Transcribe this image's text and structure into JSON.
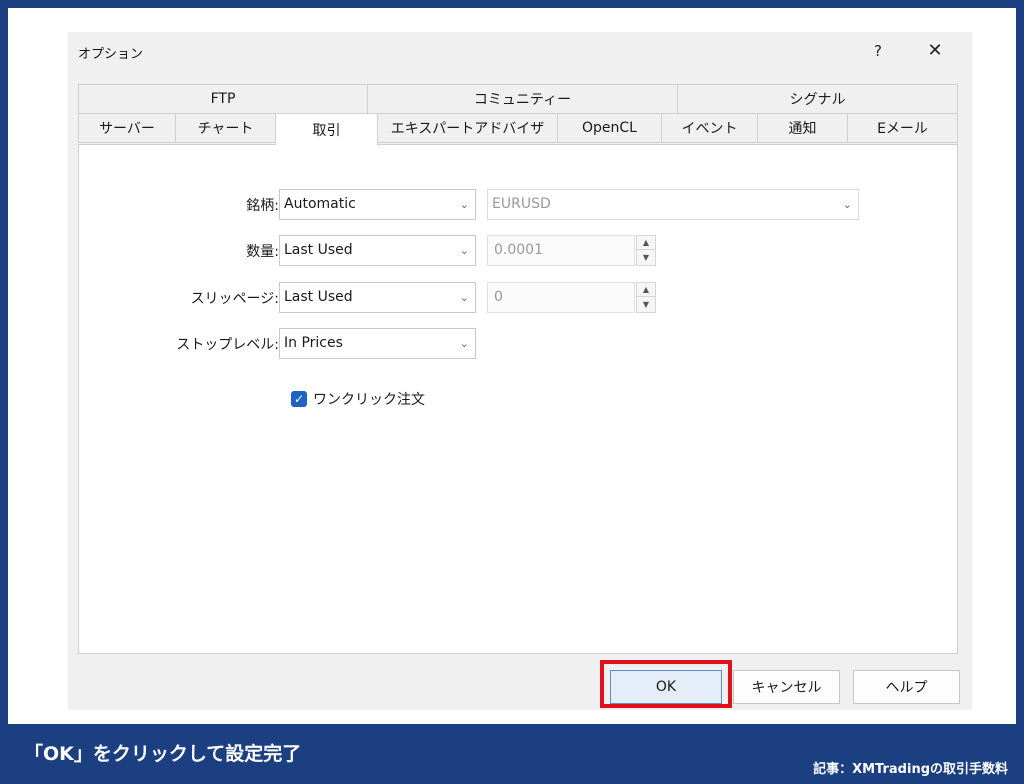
{
  "dialog": {
    "title": "オプション",
    "help": "?",
    "close": "✕"
  },
  "tabs_top": [
    "FTP",
    "コミュニティー",
    "シグナル"
  ],
  "tabs_bottom": [
    "サーバー",
    "チャート",
    "取引",
    "エキスパートアドバイザ",
    "OpenCL",
    "イベント",
    "通知",
    "Eメール"
  ],
  "active_tab": "取引",
  "form": {
    "symbol_label": "銘柄:",
    "symbol_select": "Automatic",
    "symbol_value": "EURUSD",
    "volume_label": "数量:",
    "volume_select": "Last Used",
    "volume_value": "0.0001",
    "slippage_label": "スリッページ:",
    "slippage_select": "Last Used",
    "slippage_value": "0",
    "stoplevel_label": "ストップレベル:",
    "stoplevel_select": "In Prices",
    "oneclick_label": "ワンクリック注文",
    "oneclick_checked": true
  },
  "buttons": {
    "ok": "OK",
    "cancel": "キャンセル",
    "help": "ヘルプ"
  },
  "caption": "「OK」をクリックして設定完了",
  "credit": "記事：XMTradingの取引手数料",
  "colors": {
    "background": "#1b3f80",
    "highlight": "#e0101c",
    "checkbox": "#1f63c4"
  }
}
